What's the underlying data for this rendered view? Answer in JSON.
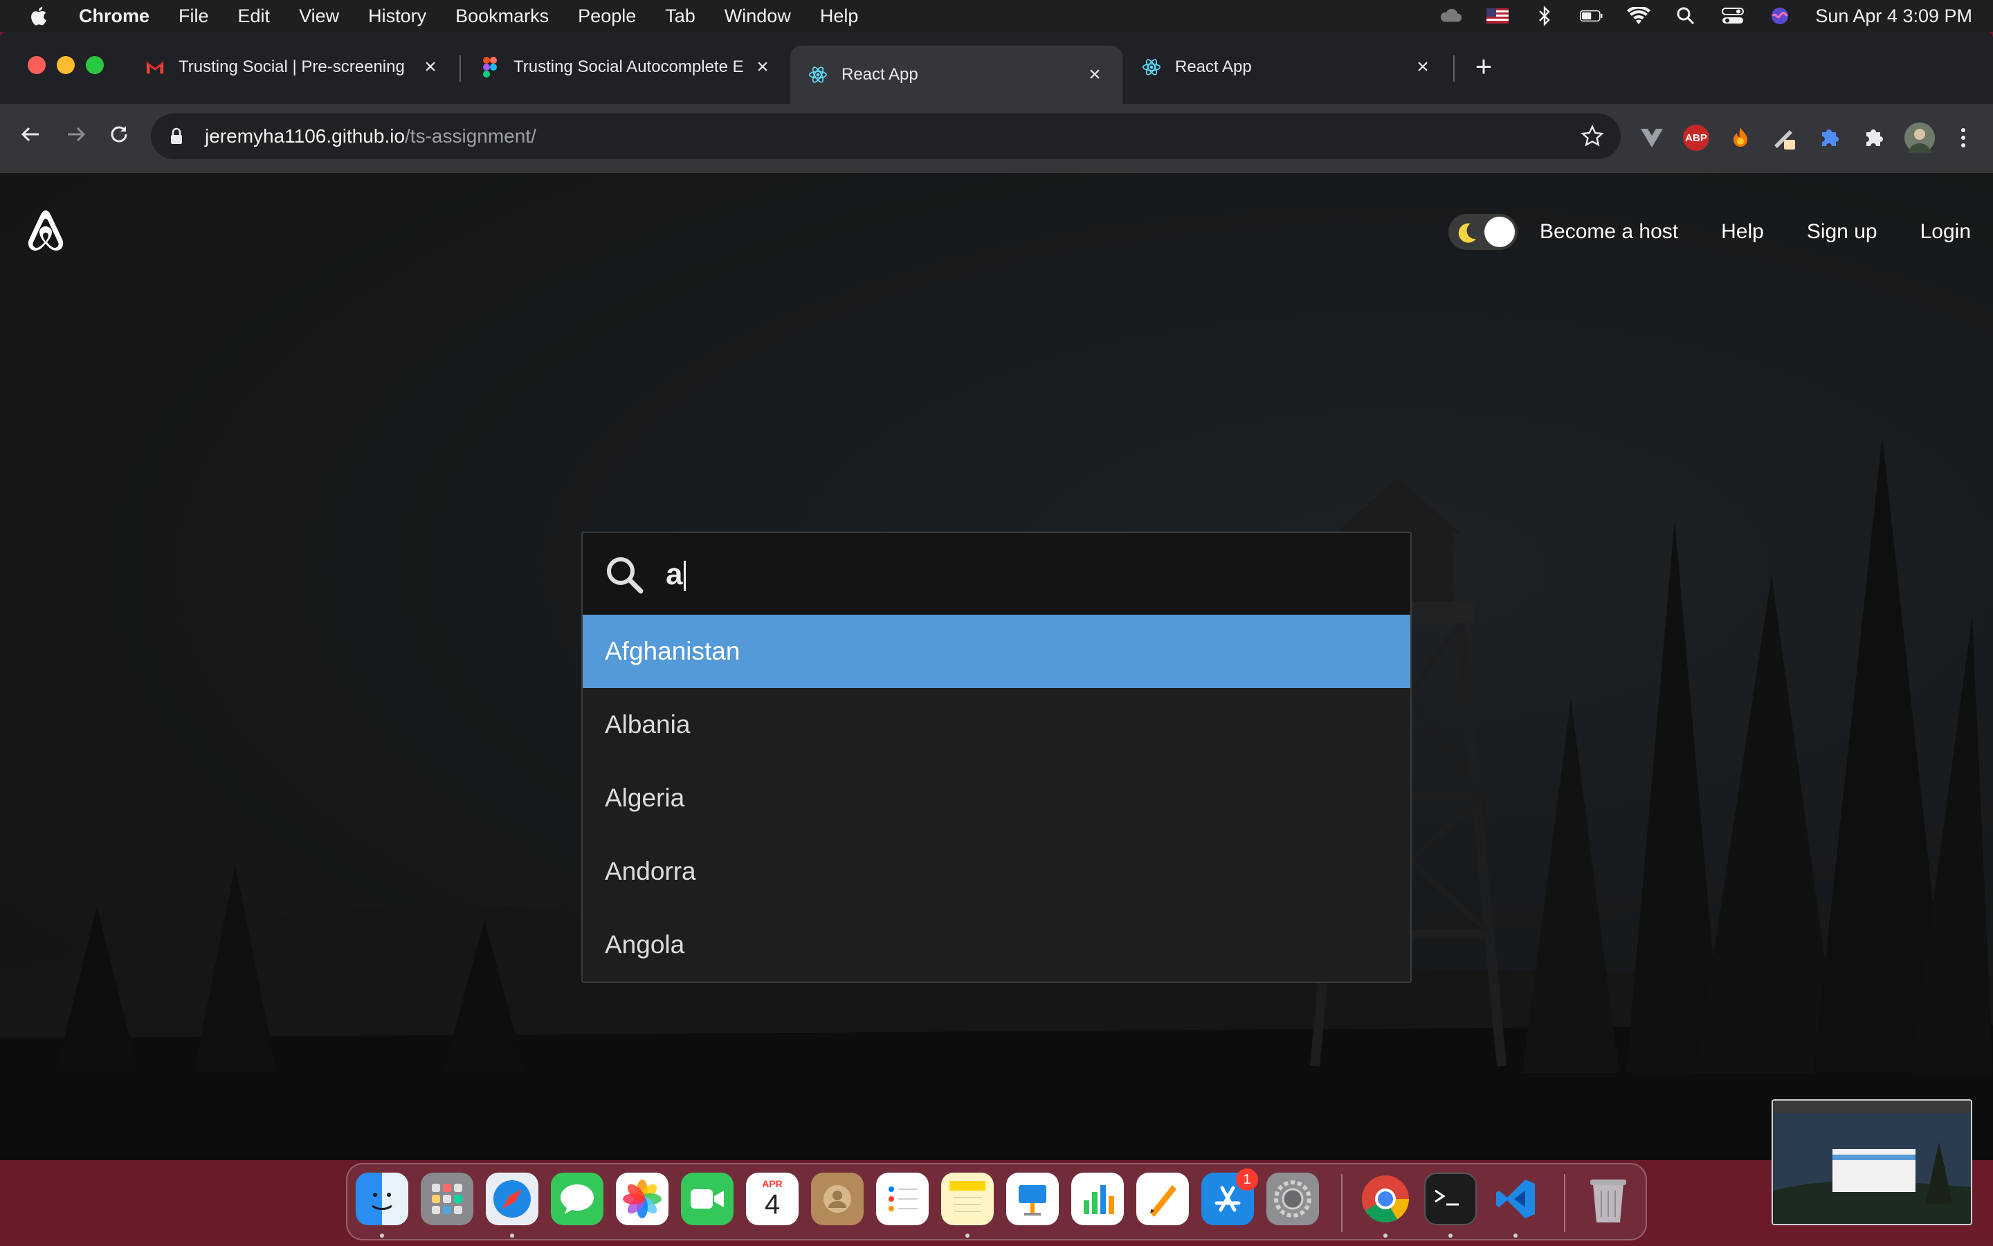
{
  "menubar": {
    "app_name": "Chrome",
    "menus": [
      "File",
      "Edit",
      "View",
      "History",
      "Bookmarks",
      "People",
      "Tab",
      "Window",
      "Help"
    ],
    "clock": "Sun Apr 4  3:09 PM"
  },
  "tabs": [
    {
      "title": "Trusting Social | Pre-screening",
      "favicon": "gmail-icon"
    },
    {
      "title": "Trusting Social Autocomplete E",
      "favicon": "figma-icon"
    },
    {
      "title": "React App",
      "favicon": "react-icon",
      "active": true
    },
    {
      "title": "React App",
      "favicon": "react-icon"
    }
  ],
  "address_bar": {
    "host": "jeremyha1106.github.io",
    "path": "/ts-assignment/"
  },
  "extensions": {
    "abp_label": "ABP"
  },
  "site": {
    "nav": {
      "become_host": "Become a host",
      "help": "Help",
      "sign_up": "Sign up",
      "login": "Login"
    },
    "search": {
      "query": "a",
      "suggestions": [
        "Afghanistan",
        "Albania",
        "Algeria",
        "Andorra",
        "Angola"
      ],
      "highlighted_index": 0
    }
  },
  "dock": {
    "calendar_month": "APR",
    "calendar_day": "4",
    "appstore_badge": "1"
  },
  "colors": {
    "highlight": "#5499d8",
    "menubar_bg": "#1f1f21",
    "dock_bg": "#6b1a2a"
  }
}
